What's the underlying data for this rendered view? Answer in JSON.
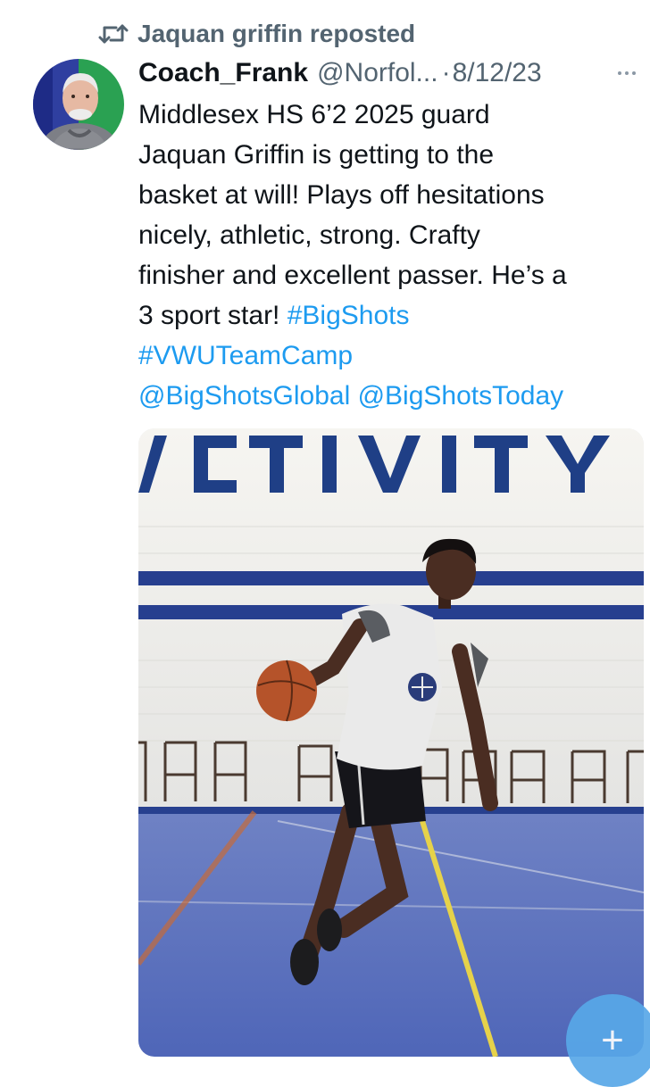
{
  "repost": {
    "icon": "repost-icon",
    "label": "Jaquan griffin reposted"
  },
  "post": {
    "avatar_icon": "avatar-photo",
    "display_name": "Coach_Frank",
    "handle": "@Norfol...",
    "separator": "·",
    "date": "8/12/23",
    "more_icon": "more-options-icon",
    "text_lines": [
      "Middlesex HS 6’2 2025 guard",
      "Jaquan Griffin is getting to the",
      "basket at will!  Plays off hesitations",
      "nicely, athletic, strong.  Crafty",
      "finisher and excellent passer.  He’s a"
    ],
    "line6_text": "3 sport star!  ",
    "hashtag1": "#BigShots",
    "hashtag2": "#VWUTeamCamp",
    "mention1": "@BigShotsGlobal",
    "mention2": "@BigShotsToday",
    "link_color": "#1d9bf0"
  },
  "media": {
    "wall_text": "ACTIVITY",
    "description_icon": "basketball-player-photo"
  },
  "fab": {
    "icon": "plus-icon",
    "symbol": "+"
  }
}
